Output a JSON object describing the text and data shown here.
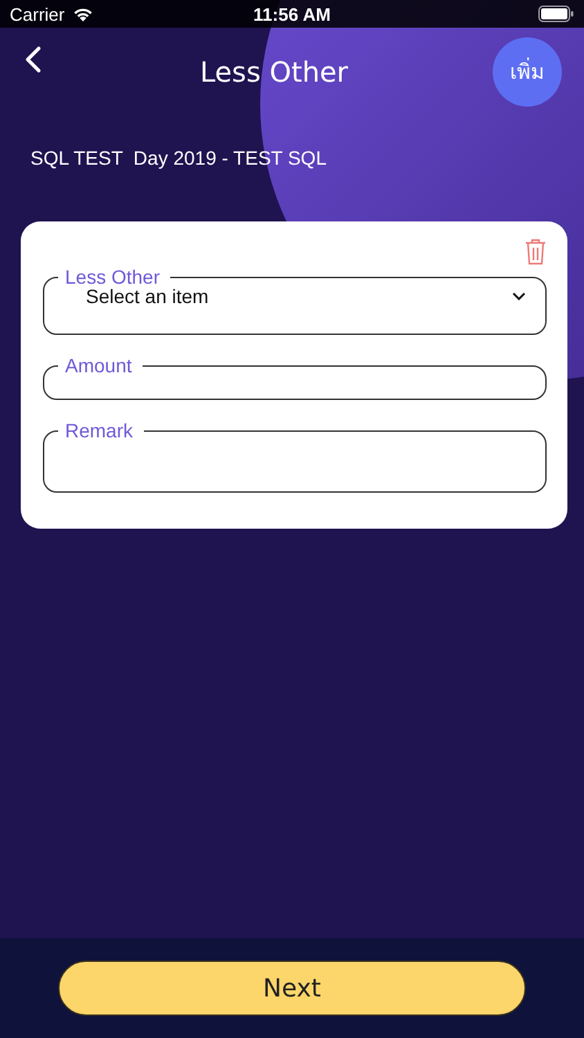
{
  "status_bar": {
    "carrier": "Carrier",
    "time": "11:56 AM"
  },
  "header": {
    "title": "Less Other",
    "add_button": "เพิ่ม"
  },
  "subtitle": "SQL TEST  Day 2019 - TEST SQL",
  "fields": [
    {
      "kind": "select",
      "label": "Less Other",
      "value": "Select an item"
    },
    {
      "kind": "text",
      "label": "Amount"
    },
    {
      "kind": "textarea",
      "label": "Remark"
    }
  ],
  "next_button": "Next"
}
